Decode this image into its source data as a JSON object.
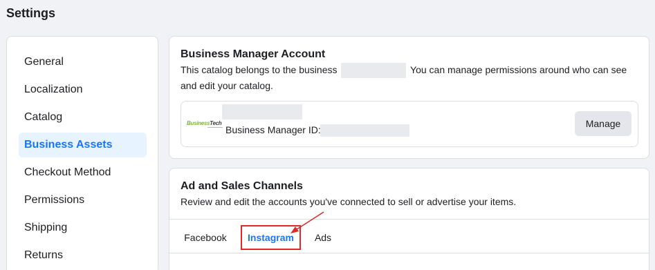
{
  "page": {
    "title": "Settings"
  },
  "sidebar": {
    "items": [
      {
        "label": "General",
        "active": false
      },
      {
        "label": "Localization",
        "active": false
      },
      {
        "label": "Catalog",
        "active": false
      },
      {
        "label": "Business Assets",
        "active": true
      },
      {
        "label": "Checkout Method",
        "active": false
      },
      {
        "label": "Permissions",
        "active": false
      },
      {
        "label": "Shipping",
        "active": false
      },
      {
        "label": "Returns",
        "active": false
      }
    ]
  },
  "business_manager": {
    "title": "Business Manager Account",
    "desc_part1": "This catalog belongs to the business",
    "desc_part2": "You can manage permissions around who can see",
    "desc_line2": "and edit your catalog.",
    "logo_text_green": "Business",
    "logo_text_dark": "Tech",
    "id_label": "Business Manager ID:",
    "manage_label": "Manage"
  },
  "channels": {
    "title": "Ad and Sales Channels",
    "description": "Review and edit the accounts you've connected to sell or advertise your items.",
    "tabs": [
      {
        "label": "Facebook",
        "active": false
      },
      {
        "label": "Instagram",
        "active": true
      },
      {
        "label": "Ads",
        "active": false
      }
    ]
  },
  "colors": {
    "accent": "#1877f2",
    "active_bg": "#e7f3ff",
    "annotation": "#e02828",
    "page_bg": "#f0f2f5"
  }
}
